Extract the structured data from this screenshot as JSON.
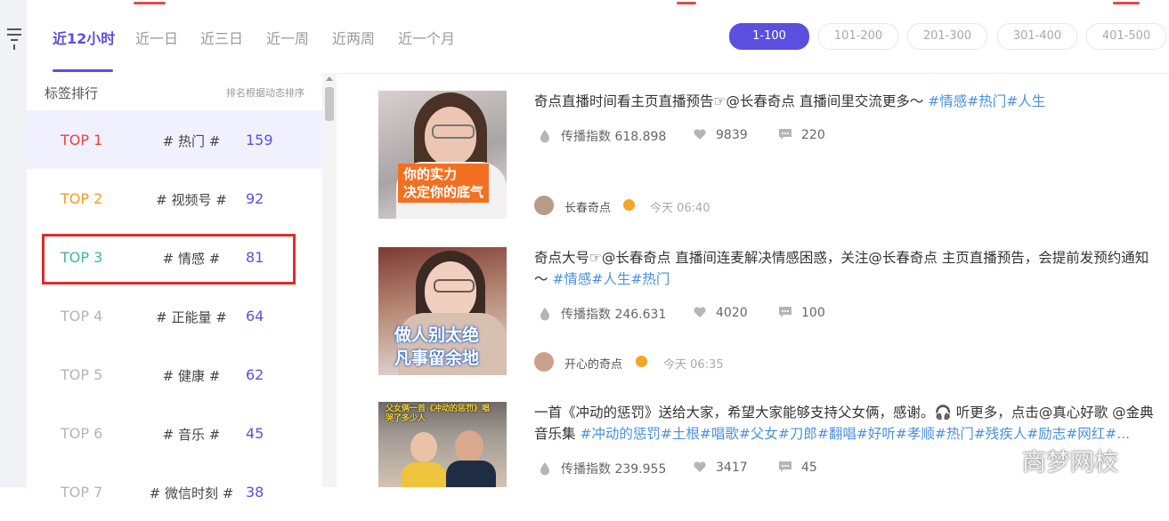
{
  "time_tabs": [
    {
      "label": "近12小时",
      "active": true
    },
    {
      "label": "近一日",
      "active": false
    },
    {
      "label": "近三日",
      "active": false
    },
    {
      "label": "近一周",
      "active": false
    },
    {
      "label": "近两周",
      "active": false
    },
    {
      "label": "近一个月",
      "active": false
    }
  ],
  "range_pills": [
    {
      "label": "1-100",
      "active": true
    },
    {
      "label": "101-200",
      "active": false
    },
    {
      "label": "201-300",
      "active": false
    },
    {
      "label": "301-400",
      "active": false
    },
    {
      "label": "401-500",
      "active": false
    }
  ],
  "sidebar": {
    "heading": "标签排行",
    "note": "排名根据动态排序",
    "ranks": [
      {
        "top": "TOP 1",
        "tag": "# 热门 #",
        "value": "159",
        "color": "#e8433a"
      },
      {
        "top": "TOP 2",
        "tag": "# 视频号 #",
        "value": "92",
        "color": "#f39a2b"
      },
      {
        "top": "TOP 3",
        "tag": "# 情感 #",
        "value": "81",
        "color": "#3fb89a"
      },
      {
        "top": "TOP 4",
        "tag": "# 正能量 #",
        "value": "64",
        "color": "#b5b5b5"
      },
      {
        "top": "TOP 5",
        "tag": "# 健康 #",
        "value": "62",
        "color": "#b5b5b5"
      },
      {
        "top": "TOP 6",
        "tag": "# 音乐 #",
        "value": "45",
        "color": "#b5b5b5"
      },
      {
        "top": "TOP 7",
        "tag": "# 微信时刻 #",
        "value": "38",
        "color": "#b5b5b5"
      }
    ]
  },
  "posts": [
    {
      "title": "奇点直播时间看主页直播预告☞@长春奇点 直播间里交流更多～ ",
      "tags": "#情感#热门#人生",
      "thumb_caption": "你的实力\n决定你的底气",
      "spread_label": "传播指数",
      "spread": "618.898",
      "likes": "9839",
      "comments": "220",
      "author": "长春奇点",
      "time": "今天 06:40"
    },
    {
      "title": "奇点大号☞@长春奇点 直播间连麦解决情感困惑，关注@长春奇点 主页直播预告，会提前发预约通知～ ",
      "tags": "#情感#人生#热门",
      "thumb_caption": "做人别太绝\n凡事留余地",
      "spread_label": "传播指数",
      "spread": "246.631",
      "likes": "4020",
      "comments": "100",
      "author": "开心的奇点",
      "time": "今天 06:35"
    },
    {
      "title": "一首《冲动的惩罚》送给大家，希望大家能够支持父女俩，感谢。🎧 听更多，点击@真心好歌 @金典音乐集 ",
      "tags": "#冲动的惩罚#土根#唱歌#父女#刀郎#翻唱#好听#孝顺#热门#残疾人#励志#网红#...",
      "thumb_caption": "父女俩一首《冲动的惩罚》唱哭了多少人",
      "spread_label": "传播指数",
      "spread": "239.955",
      "likes": "3417",
      "comments": "45"
    }
  ],
  "watermark": "商梦网校",
  "colors": {
    "accent": "#5b4fe0",
    "link": "#4a90e2",
    "highlight_box": "#e02b2b"
  }
}
